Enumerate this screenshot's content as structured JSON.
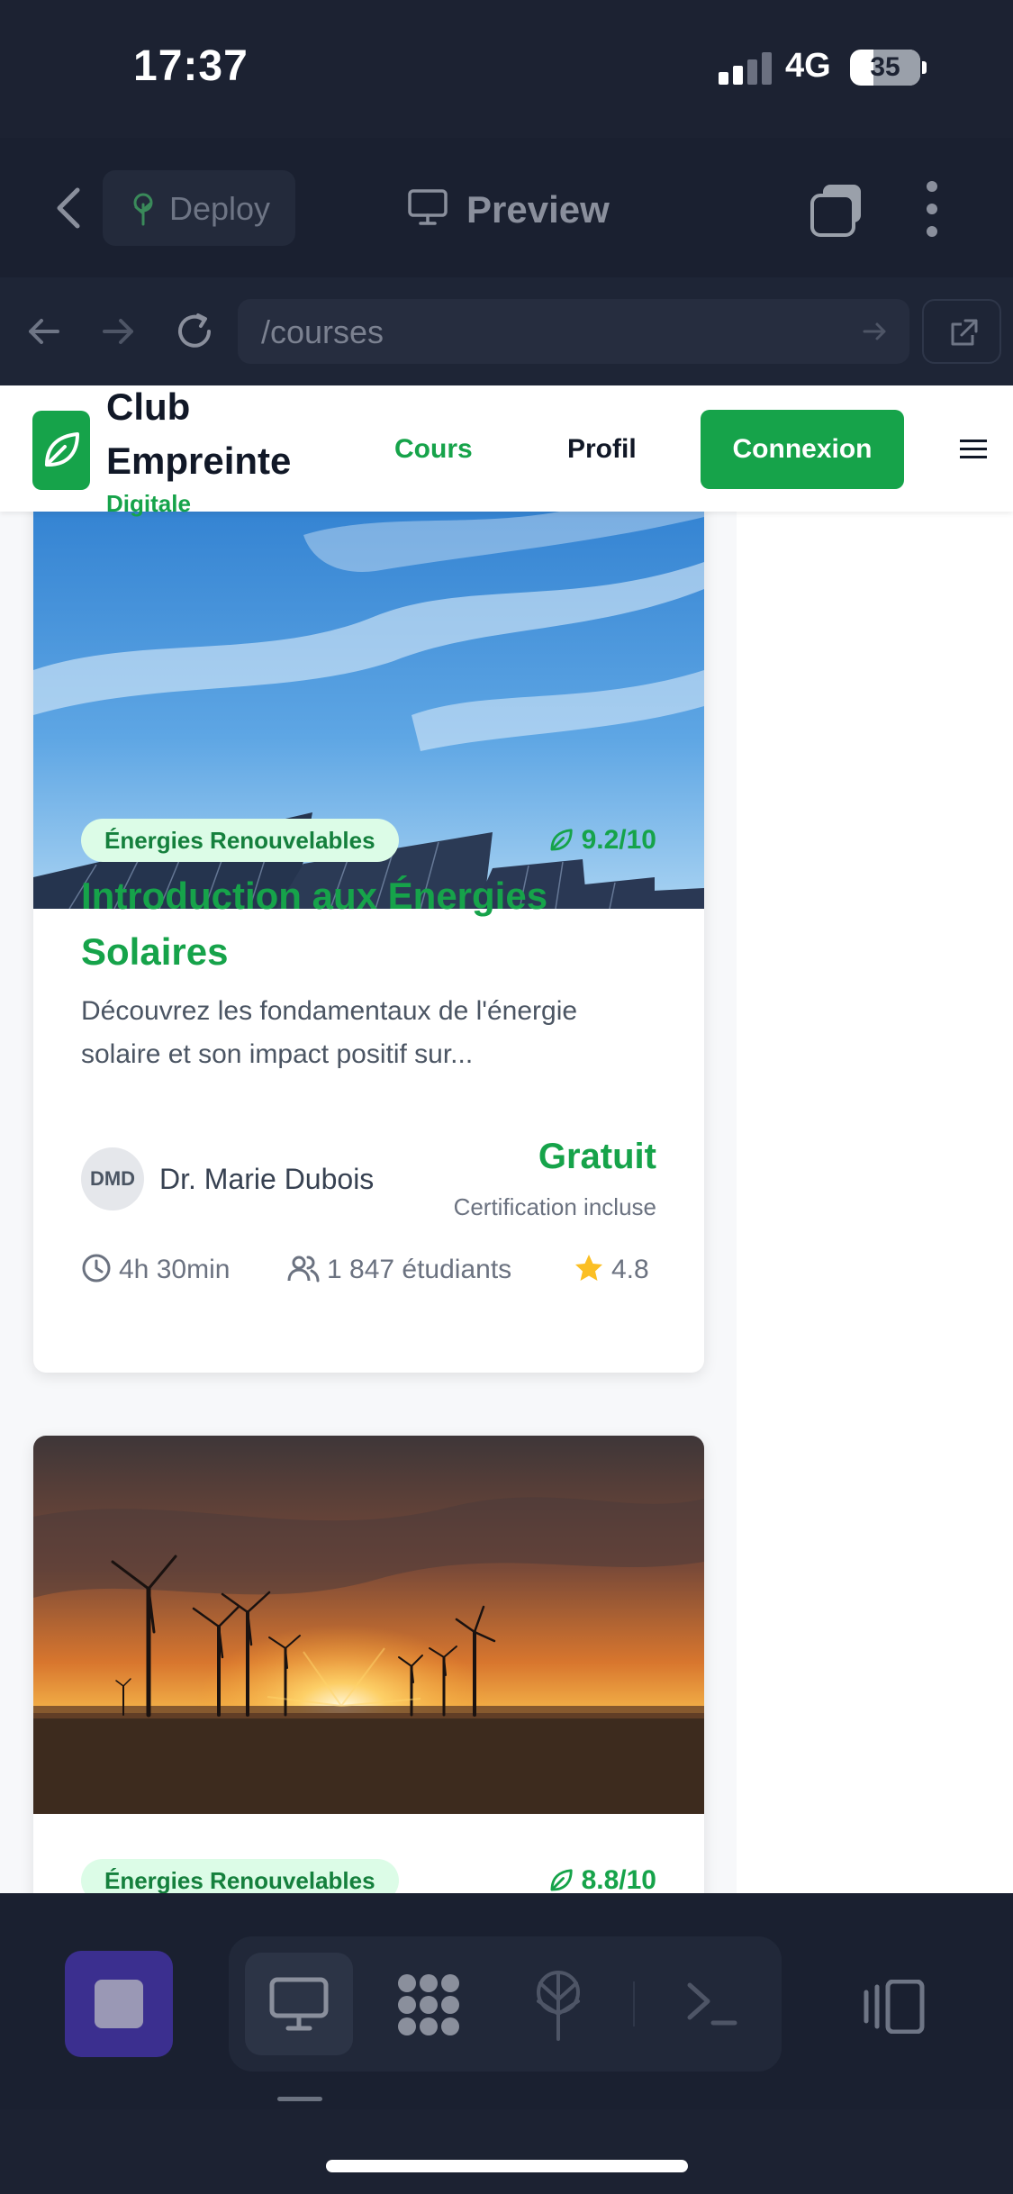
{
  "status": {
    "time": "17:37",
    "network": "4G",
    "battery": "35"
  },
  "toolbar": {
    "deploy_label": "Deploy",
    "preview_label": "Preview"
  },
  "browser": {
    "url": "/courses"
  },
  "site": {
    "brand_line1": "Club",
    "brand_line2": "Empreinte",
    "brand_line3": "Digitale",
    "nav": {
      "courses": "Cours",
      "profile": "Profil",
      "login": "Connexion"
    }
  },
  "courses": [
    {
      "category": "Énergies Renouvelables",
      "score": "9.2/10",
      "title": "Introduction aux Énergies Solaires",
      "description": "Découvrez les fondamentaux de l'énergie solaire et son impact positif sur...",
      "instructor_initials": "DMD",
      "instructor": "Dr. Marie Dubois",
      "price": "Gratuit",
      "price_note": "Certification incluse",
      "duration": "4h 30min",
      "students": "1 847 étudiants",
      "rating": "4.8"
    },
    {
      "category": "Énergies Renouvelables",
      "score": "8.8/10"
    }
  ],
  "icons": {
    "back": "chevron-left-icon",
    "deploy": "tree-icon",
    "preview": "monitor-icon",
    "tabs": "tabs-icon",
    "more": "more-vertical-icon",
    "nav_back": "arrow-left-icon",
    "nav_forward": "arrow-right-icon",
    "reload": "reload-icon",
    "open_external": "external-link-icon",
    "leaf": "leaf-icon",
    "clock": "clock-icon",
    "users": "users-icon",
    "star": "star-icon",
    "menu": "hamburger-icon",
    "stop": "stop-icon",
    "desktop": "monitor-icon",
    "apps": "grid-dots-icon",
    "network": "network-tree-icon",
    "terminal": "terminal-icon",
    "devices": "devices-icon"
  },
  "colors": {
    "accent": "#16a34a",
    "badge_bg": "#dcfce7",
    "star": "#fbbf24",
    "dark_bg": "#1c2232",
    "stop_bg": "#3b2f8f"
  }
}
